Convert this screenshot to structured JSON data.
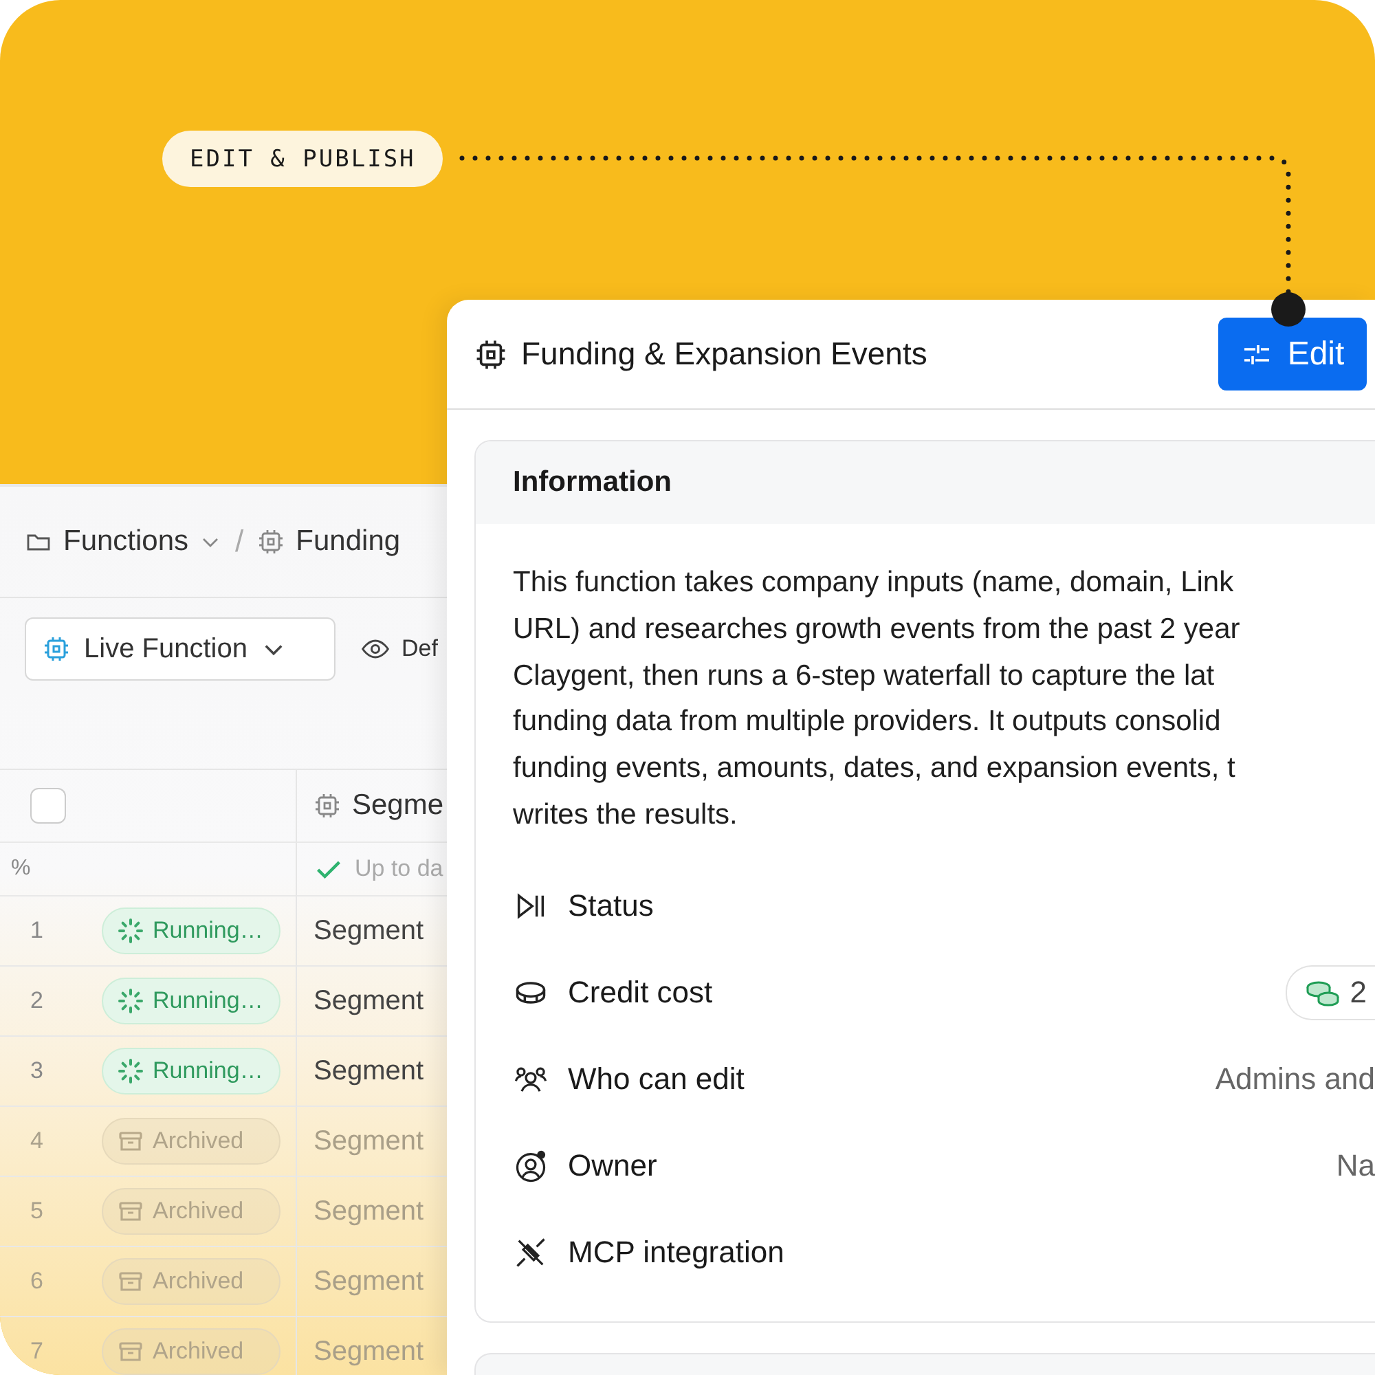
{
  "callout": {
    "label": "EDIT & PUBLISH"
  },
  "table_panel": {
    "breadcrumb": [
      {
        "label": "Functions",
        "kind": "folder",
        "dropdown": true
      },
      {
        "separator": "/",
        "label": "Funding",
        "kind": "function"
      }
    ],
    "view_select": {
      "label": "Live Function"
    },
    "view_button": {
      "label": "Def"
    },
    "header": {
      "checked": false,
      "column": "Segme",
      "index_label": "%",
      "column_status": "Up to da"
    },
    "rows": [
      {
        "index": "1",
        "status": "Running…",
        "kind": "running",
        "cell": "Segment"
      },
      {
        "index": "2",
        "status": "Running…",
        "kind": "running",
        "cell": "Segment"
      },
      {
        "index": "3",
        "status": "Running…",
        "kind": "running",
        "cell": "Segment"
      },
      {
        "index": "4",
        "status": "Archived",
        "kind": "archived",
        "cell": "Segment"
      },
      {
        "index": "5",
        "status": "Archived",
        "kind": "archived",
        "cell": "Segment"
      },
      {
        "index": "6",
        "status": "Archived",
        "kind": "archived",
        "cell": "Segment"
      },
      {
        "index": "7",
        "status": "Archived",
        "kind": "archived",
        "cell": "Segment"
      }
    ]
  },
  "detail_panel": {
    "title": "Funding & Expansion Events",
    "edit_button": "Edit",
    "information": {
      "title": "Information",
      "description_lines": [
        "This function takes company inputs (name, domain, Link",
        "URL) and researches growth events from the past 2 year",
        "Claygent, then runs a 6-step waterfall to capture the lat",
        "funding data from multiple providers. It outputs consolid",
        "funding events, amounts, dates, and expansion events, t",
        "writes the results."
      ],
      "properties": [
        {
          "label": "Status",
          "kind": "none"
        },
        {
          "label": "Credit cost",
          "kind": "badge",
          "value": "2"
        },
        {
          "label": "Who can edit",
          "kind": "text",
          "value": "Admins and"
        },
        {
          "label": "Owner",
          "kind": "text",
          "value": "Na"
        },
        {
          "label": "MCP integration",
          "kind": "none"
        }
      ]
    }
  }
}
